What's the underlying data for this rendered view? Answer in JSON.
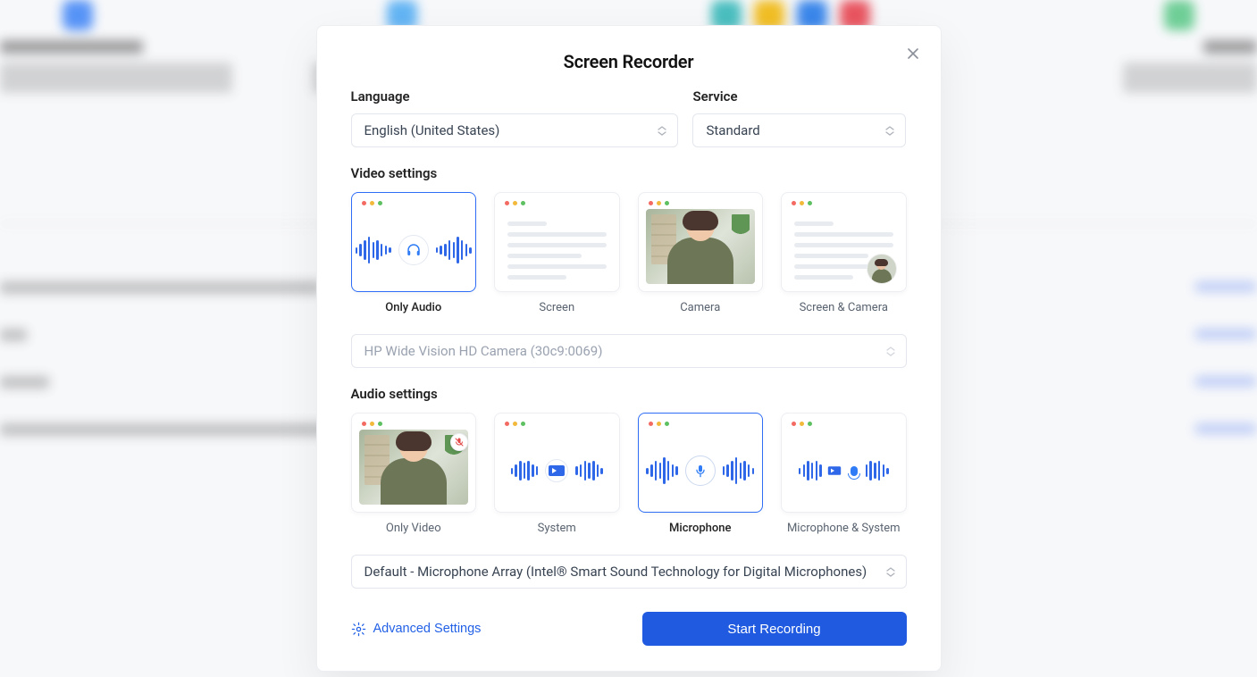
{
  "modal": {
    "title": "Screen Recorder",
    "language_label": "Language",
    "language_value": "English (United States)",
    "service_label": "Service",
    "service_value": "Standard",
    "video_settings_label": "Video settings",
    "video_options": {
      "only_audio": "Only Audio",
      "screen": "Screen",
      "camera": "Camera",
      "screen_camera": "Screen & Camera"
    },
    "camera_select": "HP Wide Vision HD Camera (30c9:0069)",
    "audio_settings_label": "Audio settings",
    "audio_options": {
      "only_video": "Only Video",
      "system": "System",
      "microphone": "Microphone",
      "microphone_system": "Microphone & System"
    },
    "audio_select": "Default - Microphone Array (Intel® Smart Sound Technology for Digital Microphones)",
    "advanced_settings": "Advanced Settings",
    "start_button": "Start Recording"
  }
}
